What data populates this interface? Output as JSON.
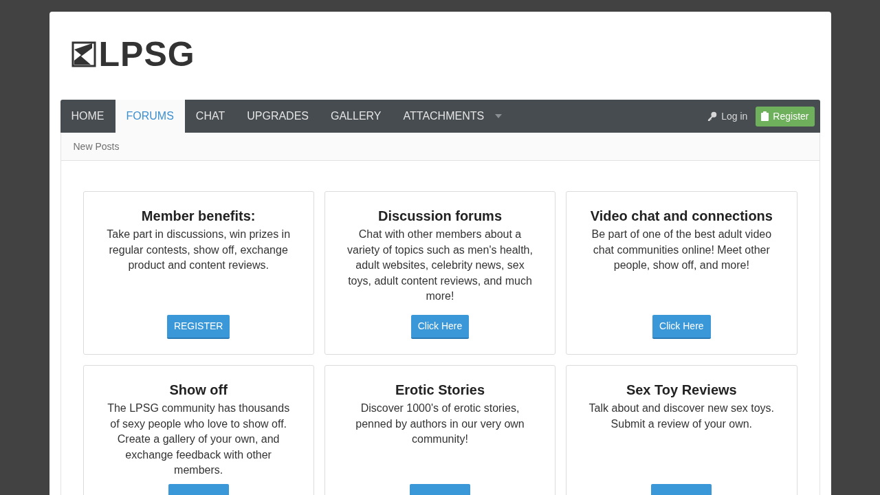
{
  "logo": {
    "text": "LPSG"
  },
  "nav": {
    "tabs": [
      {
        "label": "HOME",
        "selected": false,
        "dropdown": false
      },
      {
        "label": "FORUMS",
        "selected": true,
        "dropdown": false
      },
      {
        "label": "CHAT",
        "selected": false,
        "dropdown": false
      },
      {
        "label": "UPGRADES",
        "selected": false,
        "dropdown": false
      },
      {
        "label": "GALLERY",
        "selected": false,
        "dropdown": false
      },
      {
        "label": "ATTACHMENTS",
        "selected": false,
        "dropdown": true
      }
    ],
    "login": "Log in",
    "register": "Register"
  },
  "subnav": [
    "New Posts"
  ],
  "cards": [
    {
      "title": "Member benefits:",
      "text": "Take part in discussions, win prizes in regular contests, show off, exchange product and content reviews.",
      "button_label": "REGISTER"
    },
    {
      "title": "Discussion forums",
      "text": "Chat with other members about a variety of topics such as men's health, adult websites, celebrity news, sex toys, adult content reviews, and much more!",
      "button_label": "Click Here"
    },
    {
      "title": "Video chat and connections",
      "text": "Be part of one of the best adult video chat communities online! Meet other people, show off, and more!",
      "button_label": "Click Here"
    },
    {
      "title": "Show off",
      "text": "The LPSG community has thousands of sexy people who love to show off. Create a gallery of your own, and exchange feedback with other members.",
      "button_visible": true
    },
    {
      "title": "Erotic Stories",
      "text": "Discover 1000's of erotic stories, penned by authors in our very own community!",
      "button_visible": true
    },
    {
      "title": "Sex Toy Reviews",
      "text": "Talk about and discover new sex toys. Submit a review of your own.",
      "button_visible": true
    }
  ]
}
